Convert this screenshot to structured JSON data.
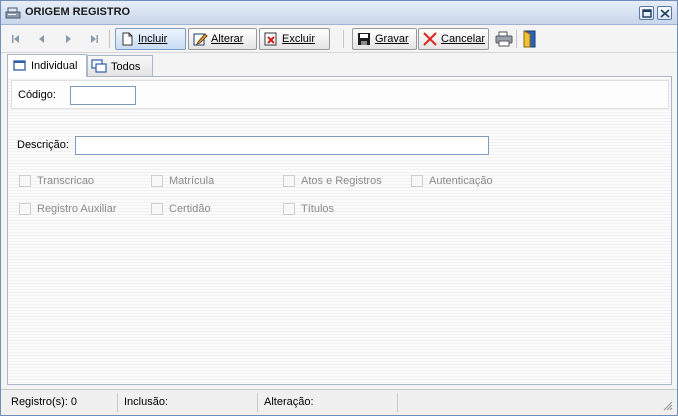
{
  "window": {
    "title": "ORIGEM REGISTRO"
  },
  "icons": {
    "app": "scanner-icon",
    "restore": "restore-icon",
    "close": "close-icon",
    "first": "first-record-icon",
    "prev": "previous-record-icon",
    "next": "next-record-icon",
    "last": "last-record-icon",
    "incluir": "new-document-icon",
    "alterar": "edit-icon",
    "excluir": "delete-icon",
    "gravar": "save-icon",
    "cancelar": "cancel-icon",
    "print": "printer-icon",
    "exit": "exit-door-icon"
  },
  "toolbar": {
    "incluir_label": "Incluir",
    "alterar_label": "Alterar",
    "excluir_label": "Excluir",
    "gravar_label": "Gravar",
    "cancelar_label": "Cancelar"
  },
  "tabs": [
    {
      "label": "Individual",
      "active": true
    },
    {
      "label": "Todos",
      "active": false
    }
  ],
  "form": {
    "codigo_label": "Código:",
    "codigo_value": "",
    "descricao_label": "Descrição:",
    "descricao_value": ""
  },
  "checkboxes": [
    {
      "label": "Transcricao",
      "checked": false
    },
    {
      "label": "Matrícula",
      "checked": false
    },
    {
      "label": "Atos e Registros",
      "checked": false
    },
    {
      "label": "Autenticação",
      "checked": false
    },
    {
      "label": "Registro Auxiliar",
      "checked": false
    },
    {
      "label": "Certidão",
      "checked": false
    },
    {
      "label": "Títulos",
      "checked": false
    }
  ],
  "status": {
    "registros": "Registro(s): 0",
    "inclusao": "Inclusão:",
    "alteracao": "Alteração:"
  },
  "colors": {
    "accent": "#c8dcf3",
    "border": "#7f9db9",
    "disabled_text": "#8a8a8a"
  }
}
